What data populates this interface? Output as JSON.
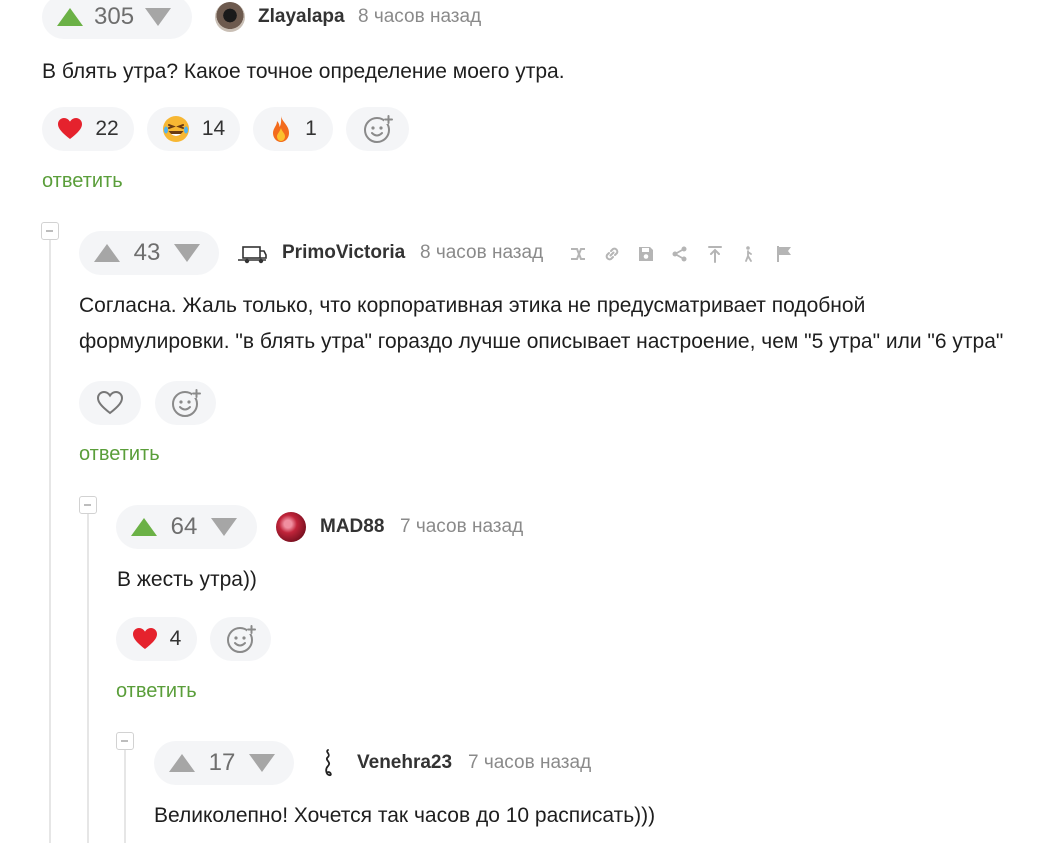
{
  "colors": {
    "upvote": "#6bb146",
    "downvote": "#a6a6a6",
    "heart": "#e5222d",
    "reply": "#5a9e3a"
  },
  "comments": [
    {
      "votes": "305",
      "author": "Zlayalapa",
      "time": "8 часов назад",
      "text": "В блять утра? Какое точное определение моего утра.",
      "reactions": [
        {
          "icon": "heart-icon",
          "count": "22"
        },
        {
          "icon": "laughing-face-icon",
          "count": "14"
        },
        {
          "icon": "fire-icon",
          "count": "1"
        }
      ],
      "reply_label": "ответить"
    },
    {
      "votes": "43",
      "author": "PrimoVictoria",
      "time": "8 часов назад",
      "text_lines": [
        "Согласна. Жаль только, что корпоративная этика не предусматривает подобной",
        "формулировки. \"в блять утра\" гораздо лучше описывает настроение, чем \"5 утра\" или \"6 утра\""
      ],
      "action_icons": [
        "branch-icon",
        "link-icon",
        "save-icon",
        "share-icon",
        "scroll-top-icon",
        "walk-icon",
        "flag-icon"
      ],
      "reply_label": "ответить"
    },
    {
      "votes": "64",
      "author": "MAD88",
      "time": "7 часов назад",
      "text": "В жесть утра))",
      "reactions": [
        {
          "icon": "heart-icon",
          "count": "4"
        }
      ],
      "reply_label": "ответить"
    },
    {
      "votes": "17",
      "author": "Venehra23",
      "time": "7 часов назад",
      "text": "Великолепно! Хочется так часов до 10 расписать)))"
    }
  ]
}
